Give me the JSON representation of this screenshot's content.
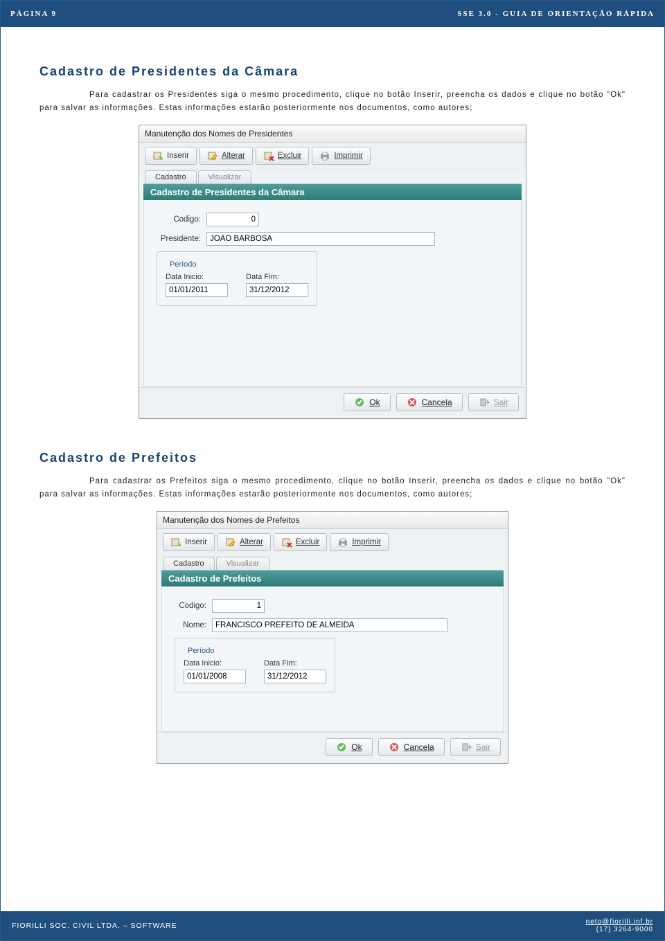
{
  "header": {
    "page_label": "PÁGINA 9",
    "doc_title": "SSE 3.0 - GUIA DE ORIENTAÇÃO RÁPIDA"
  },
  "section1": {
    "title": "Cadastro de Presidentes da Câmara",
    "para": "Para cadastrar os Presidentes siga o mesmo procedimento, clique no botão Inserir, preencha os dados e clique no botão \"Ok\" para salvar as informações. Estas informações estarão posteriormente nos documentos, como autores;"
  },
  "win1": {
    "title": "Manutenção dos Nomes de Presidentes",
    "toolbar": {
      "insert": "Inserir",
      "alter": "Alterar",
      "delete": "Excluir",
      "print": "Imprimir"
    },
    "tabs": {
      "cad": "Cadastro",
      "vis": "Visualizar"
    },
    "banner": "Cadastro de Presidentes da Câmara",
    "form": {
      "codigo_label": "Codigo:",
      "codigo_value": "0",
      "presidente_label": "Presidente:",
      "presidente_value": "JOAO BARBOSA",
      "periodo_legend": "Período",
      "inicio_label": "Data Inicio:",
      "inicio_value": "01/01/2011",
      "fim_label": "Data Fim:",
      "fim_value": "31/12/2012"
    },
    "buttons": {
      "ok": "Ok",
      "cancel": "Cancela",
      "exit": "Sair"
    }
  },
  "section2": {
    "title": "Cadastro de Prefeitos",
    "para": "Para cadastrar os Prefeitos siga o mesmo procedimento, clique no botão Inserir, preencha os dados e clique no botão \"Ok\" para salvar as informações. Estas informações estarão posteriormente nos documentos, como autores;"
  },
  "win2": {
    "title": "Manutenção dos Nomes de Prefeitos",
    "toolbar": {
      "insert": "Inserir",
      "alter": "Alterar",
      "delete": "Excluir",
      "print": "Imprimir"
    },
    "tabs": {
      "cad": "Cadastro",
      "vis": "Visualizar"
    },
    "banner": "Cadastro de Prefeitos",
    "form": {
      "codigo_label": "Codigo:",
      "codigo_value": "1",
      "nome_label": "Nome:",
      "nome_value": "FRANCISCO PREFEITO DE ALMEIDA",
      "periodo_legend": "Período",
      "inicio_label": "Data Inicio:",
      "inicio_value": "01/01/2008",
      "fim_label": "Data Fim:",
      "fim_value": "31/12/2012"
    },
    "buttons": {
      "ok": "Ok",
      "cancel": "Cancela",
      "exit": "Sair"
    }
  },
  "footer": {
    "company": "FIORILLI SOC. CIVIL LTDA. – SOFTWARE",
    "email": "neto@fiorilli.inf.br",
    "phone": "(17) 3264-9000"
  }
}
